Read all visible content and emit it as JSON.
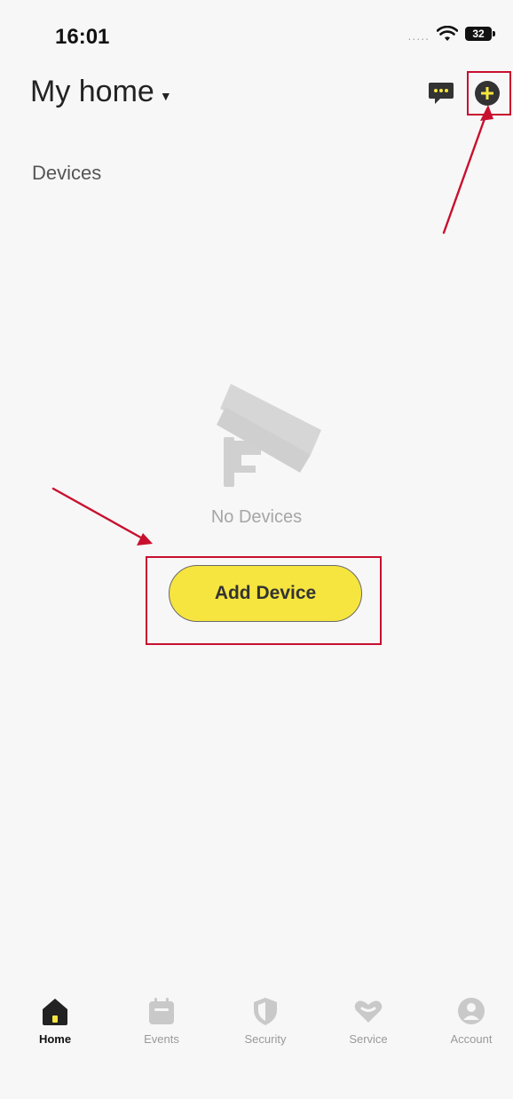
{
  "status_bar": {
    "time": "16:01",
    "battery": "32",
    "signal_dots": "....."
  },
  "header": {
    "title": "My home"
  },
  "section": {
    "devices_label": "Devices"
  },
  "empty_state": {
    "text": "No Devices",
    "button_label": "Add Device"
  },
  "colors": {
    "accent": "#f6e53f",
    "annotation": "#c8102e",
    "icon_dark": "#333333",
    "muted": "#a6a6a6"
  },
  "tabs": [
    {
      "label": "Home",
      "icon": "home-icon",
      "active": true
    },
    {
      "label": "Events",
      "icon": "calendar-icon",
      "active": false
    },
    {
      "label": "Security",
      "icon": "shield-icon",
      "active": false
    },
    {
      "label": "Service",
      "icon": "heart-chat-icon",
      "active": false
    },
    {
      "label": "Account",
      "icon": "person-icon",
      "active": false
    }
  ]
}
